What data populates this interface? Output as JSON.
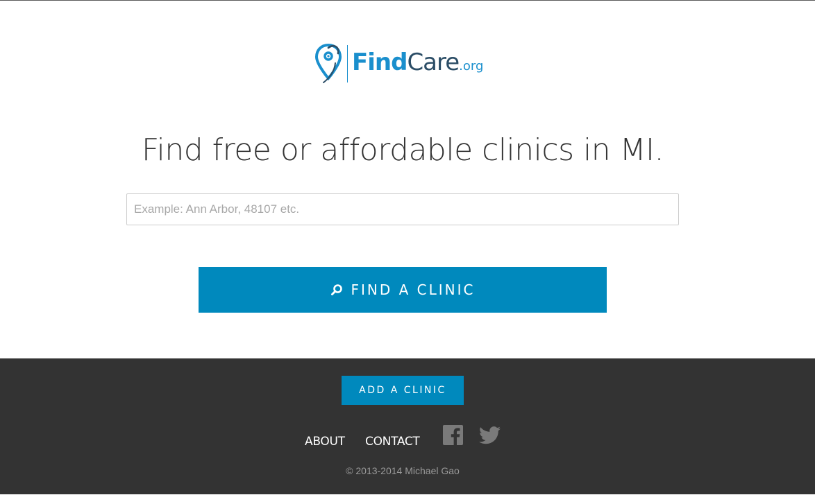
{
  "logo": {
    "find": "Find",
    "care": "Care",
    "org": ".org"
  },
  "headline": "Find free or affordable clinics in MI.",
  "search": {
    "placeholder": "Example: Ann Arbor, 48107 etc.",
    "value": ""
  },
  "find_button": {
    "label": "FIND A CLINIC",
    "icon": "search-icon"
  },
  "footer": {
    "add_clinic_label": "ADD A CLINIC",
    "links": [
      {
        "label": "ABOUT"
      },
      {
        "label": "CONTACT"
      }
    ],
    "social": [
      {
        "icon": "facebook-icon"
      },
      {
        "icon": "twitter-icon"
      }
    ],
    "copyright": "© 2013-2014 Michael Gao"
  },
  "colors": {
    "brand_blue": "#0089bd",
    "logo_blue": "#1a8fcd",
    "logo_dark": "#2b4d66",
    "footer_bg": "#333333",
    "social_icon": "#7a7a7a"
  }
}
